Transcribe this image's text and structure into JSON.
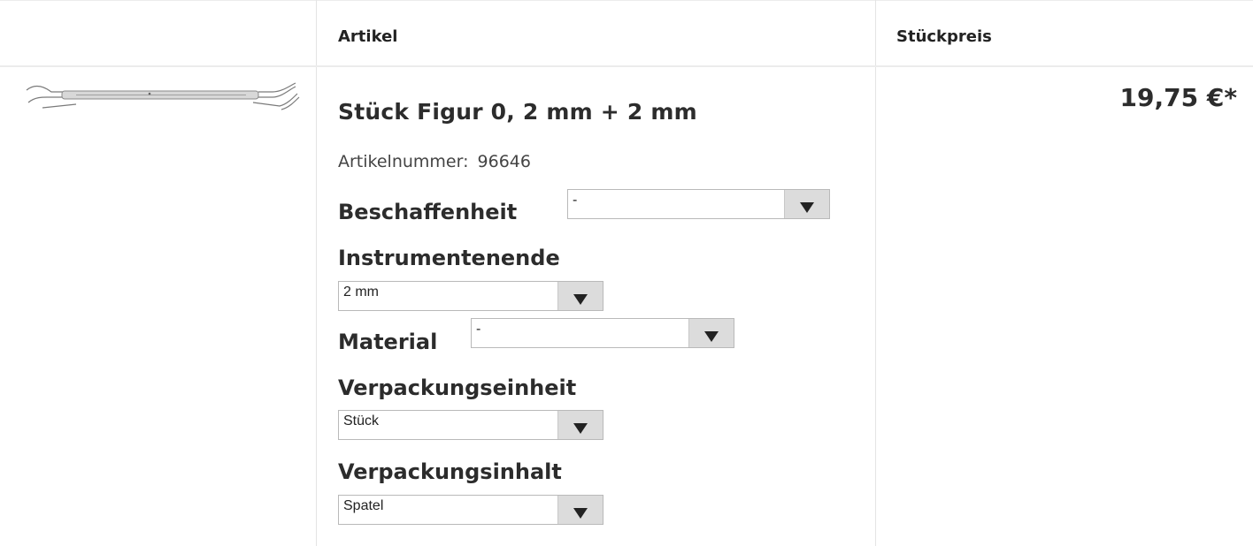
{
  "table": {
    "header": {
      "empty_col": "",
      "article_col": "Artikel",
      "price_col": "Stückpreis"
    }
  },
  "product": {
    "image_icon": "instrument-thumbnail",
    "title": "Stück Figur 0, 2 mm + 2 mm",
    "article_number_label": "Artikelnummer:",
    "article_number": "96646",
    "price": "19,75 €*"
  },
  "options": {
    "beschaffenheit": {
      "label": "Beschaffenheit",
      "value": "-"
    },
    "instrumentenende": {
      "label": "Instrumentenende",
      "value": "2 mm"
    },
    "material": {
      "label": "Material",
      "value": "-"
    },
    "verpackungseinheit": {
      "label": "Verpackungseinheit",
      "value": "Stück"
    },
    "verpackungsinhalt": {
      "label": "Verpackungsinhalt",
      "value": "Spatel"
    }
  }
}
